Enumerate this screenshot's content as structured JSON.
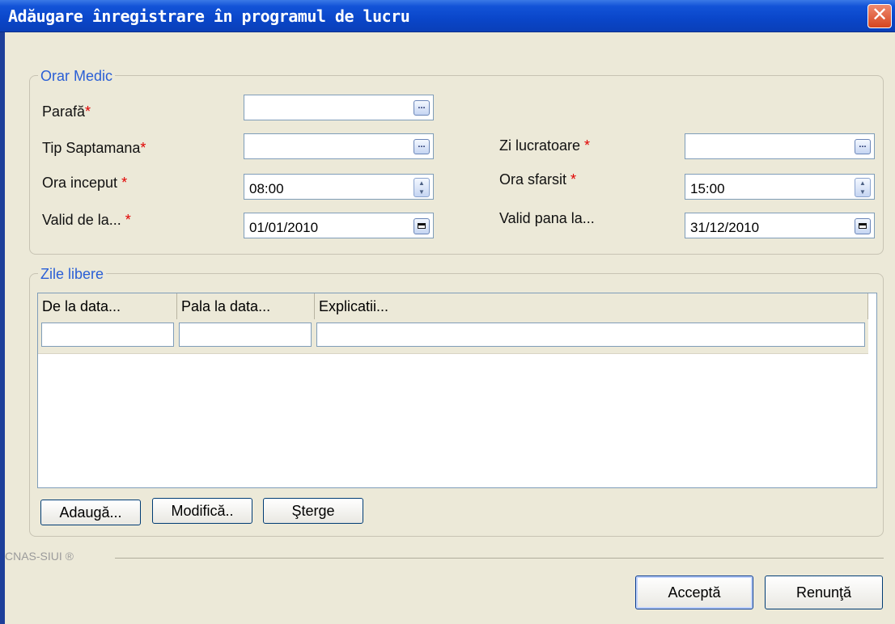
{
  "window": {
    "title": "Adăugare înregistrare în programul de lucru",
    "close_glyph": "✕"
  },
  "orar_medic": {
    "legend": "Orar Medic",
    "parafa": {
      "label": "Parafă",
      "value": ""
    },
    "tip_saptamana": {
      "label": "Tip Saptamana",
      "value": ""
    },
    "zi_lucratoare": {
      "label": "Zi lucratoare ",
      "value": ""
    },
    "ora_inceput": {
      "label": "Ora inceput ",
      "value": "08:00"
    },
    "ora_sfarsit": {
      "label": "Ora sfarsit ",
      "value": "15:00"
    },
    "valid_de_la": {
      "label": "Valid de la... ",
      "value": "01/01/2010"
    },
    "valid_pana_la": {
      "label": "Valid pana la...",
      "value": "31/12/2010"
    },
    "required_marker": "*"
  },
  "zile_libere": {
    "legend": "Zile libere",
    "columns": [
      "De la data...",
      "Pala la data...",
      "Explicatii..."
    ],
    "rows": [
      [
        "",
        "",
        ""
      ]
    ],
    "buttons": {
      "add": "Adaugă...",
      "edit": "Modifică..",
      "delete": "Şterge"
    }
  },
  "footer": {
    "copyright": "CNAS-SIUI ®",
    "accept": "Acceptă",
    "cancel": "Renunţă"
  },
  "icons": {
    "ellipsis": "...",
    "spin_up": "▲",
    "spin_down": "▼"
  },
  "colors": {
    "titlebar": "#0a46c9",
    "window_bg": "#ece9d8",
    "legend_text": "#2a5fd6",
    "required": "#e00000",
    "close_button": "#d5451f"
  }
}
